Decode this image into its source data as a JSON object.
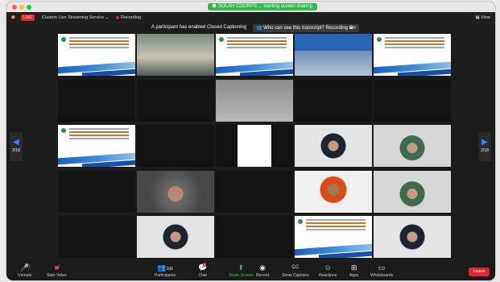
{
  "window": {
    "share_banner": "SOLAH COORPS ... starting screen sharing",
    "traffic_colors": [
      "#fe5f57",
      "#febc2e",
      "#28c840"
    ]
  },
  "topbar": {
    "live_label": "LIVE",
    "stream_label": "Custom Live Streaming Service",
    "recording_label": "Recording",
    "view_label": "View"
  },
  "notice": {
    "message": "A participant has enabled Closed Captioning",
    "who_can_see": "Who can see this transcript? Recording On"
  },
  "pager": {
    "left": "2/18",
    "right": "2/18"
  },
  "toolbar": {
    "unmute": "Unmute",
    "start_video": "Start Video",
    "participants": "Participants",
    "participants_count": "100",
    "chat": "Chat",
    "chat_badge": "2",
    "share_screen": "Share Screen",
    "record": "Record",
    "show_captions": "Show Captions",
    "reactions": "Reactions",
    "apps": "Apps",
    "whiteboards": "Whiteboards",
    "leave": "Leave",
    "cc": "CC"
  }
}
